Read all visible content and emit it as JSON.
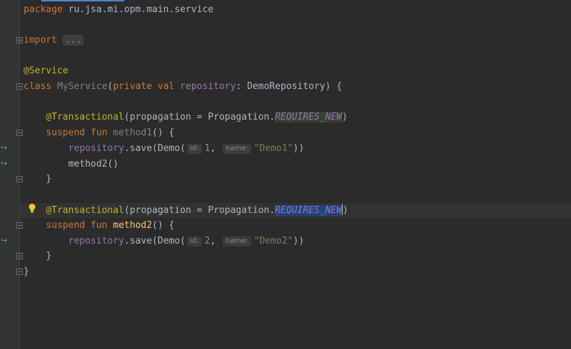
{
  "editor": {
    "package_kw": "package",
    "package_name": " ru.jsa.mi.opm.main.service",
    "import_kw": "import",
    "import_folded": "...",
    "service_annotation": "@Service",
    "class_kw": "class",
    "class_name": " MyService",
    "class_paren_open": "(",
    "private_kw": "private",
    "val_kw": " val",
    "repository_prop": " repository",
    "class_type": ": DemoRepository) {",
    "transactional_annotation": "@Transactional",
    "propagation_expr": "(propagation = Propagation.",
    "requires_new": "REQUIRES_NEW",
    "close_paren": ")",
    "suspend_kw": "suspend",
    "fun_kw": " fun",
    "method1_name": " method1",
    "method1_rest": "() {",
    "repository_call": "repository",
    "save_call": ".save(Demo(",
    "hint_id": "id:",
    "hint_name": "name:",
    "id1": "1",
    "name1": "\"Demo1\"",
    "call_end": "))",
    "comma": ",",
    "method2_call": "method2()",
    "brace_close": "}",
    "method2_name": " method2",
    "method2_rest": "() {",
    "id2": "2",
    "name2": "\"Demo2\""
  },
  "gutter_icons": [
    "fold-icon",
    "run-icon",
    "bulb-icon"
  ],
  "colors": {
    "background": "#2b2b2b",
    "keyword": "#cc7832",
    "annotation": "#bbb529",
    "string": "#6a8759",
    "number": "#6897bb",
    "property": "#9876aa",
    "function": "#ffc66d",
    "selection": "#214283"
  }
}
